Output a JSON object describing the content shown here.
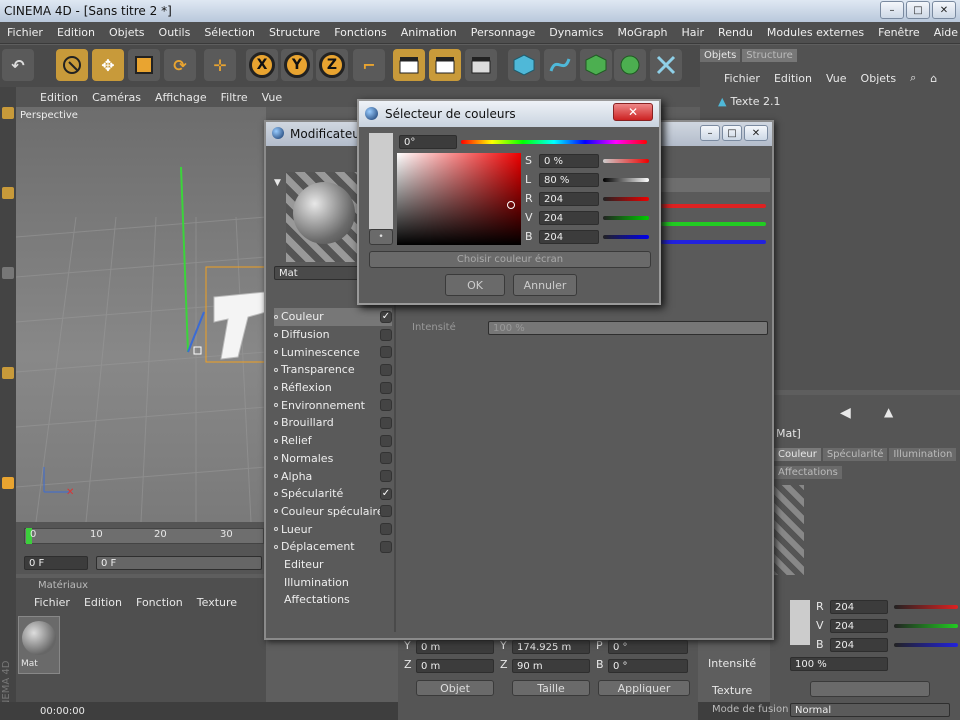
{
  "window": {
    "title": "CINEMA 4D - [Sans titre 2 *]",
    "buttons": [
      "–",
      "□",
      "✕"
    ]
  },
  "menu": [
    "Fichier",
    "Edition",
    "Objets",
    "Outils",
    "Sélection",
    "Structure",
    "Fonctions",
    "Animation",
    "Personnage",
    "Dynamics",
    "MoGraph",
    "Hair",
    "Rendu",
    "Modules externes",
    "Fenêtre",
    "Aide"
  ],
  "toolbar": {
    "x": "X",
    "y": "Y",
    "z": "Z"
  },
  "viewport": {
    "menu": [
      "Edition",
      "Caméras",
      "Affichage",
      "Filtre",
      "Vue"
    ],
    "label": "Perspective"
  },
  "timeline": {
    "ticks": [
      "0",
      "10",
      "20",
      "30"
    ],
    "current": "0 F",
    "start": "0 F"
  },
  "materials": {
    "title": "Matériaux",
    "menu": [
      "Fichier",
      "Edition",
      "Fonction",
      "Texture"
    ],
    "item": "Mat"
  },
  "status": {
    "time": "00:00:00",
    "brand": "CINEMA 4D"
  },
  "objects": {
    "tabs": [
      "Objets",
      "Structure"
    ],
    "menu": [
      "Fichier",
      "Edition",
      "Vue",
      "Objets"
    ],
    "item": "Texte 2.1"
  },
  "attributes": {
    "mat": "Mat]",
    "tabs": [
      "Couleur",
      "Spécularité",
      "Illumination"
    ],
    "tab2": "Affectations",
    "r": "204",
    "v": "204",
    "b": "204",
    "intensite_label": "Intensité",
    "intensite": "100 %",
    "texture": "Texture",
    "mode": "Mode de fusion",
    "mode_val": "Normal"
  },
  "coords": {
    "y1": "0 m",
    "y2": "174.925 m",
    "p": "0 °",
    "z1": "0 m",
    "z2": "90 m",
    "b": "0 °",
    "labels": {
      "y": "Y",
      "z": "Z",
      "p": "P",
      "b": "B"
    },
    "sel1": "Objet",
    "sel2": "Taille",
    "apply": "Appliquer"
  },
  "mated": {
    "title": "Modificateur",
    "name": "Mat",
    "intensite": "Intensité",
    "intval": "100 %",
    "channels": [
      {
        "label": "Couleur",
        "checked": true
      },
      {
        "label": "Diffusion",
        "checked": false
      },
      {
        "label": "Luminescence",
        "checked": false
      },
      {
        "label": "Transparence",
        "checked": false
      },
      {
        "label": "Réflexion",
        "checked": false
      },
      {
        "label": "Environnement",
        "checked": false
      },
      {
        "label": "Brouillard",
        "checked": false
      },
      {
        "label": "Relief",
        "checked": false
      },
      {
        "label": "Normales",
        "checked": false
      },
      {
        "label": "Alpha",
        "checked": false
      },
      {
        "label": "Spécularité",
        "checked": true
      },
      {
        "label": "Couleur spéculaire",
        "checked": false
      },
      {
        "label": "Lueur",
        "checked": false
      },
      {
        "label": "Déplacement",
        "checked": false
      }
    ],
    "extras": [
      "Editeur",
      "Illumination",
      "Affectations"
    ]
  },
  "picker": {
    "title": "Sélecteur de couleurs",
    "hue": "0°",
    "s_label": "S",
    "s": "0 %",
    "l_label": "L",
    "l": "80 %",
    "r_label": "R",
    "r": "204",
    "v_label": "V",
    "v": "204",
    "b_label": "B",
    "b": "204",
    "screen": "Choisir couleur écran",
    "ok": "OK",
    "cancel": "Annuler"
  }
}
